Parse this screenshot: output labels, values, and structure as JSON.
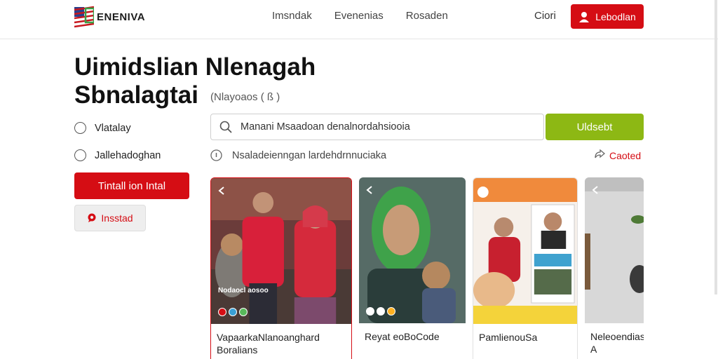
{
  "header": {
    "logo_text": "ENENIVA",
    "nav": [
      "Imsndak",
      "Evenenias",
      "Rosaden"
    ],
    "login": "Ciori",
    "signup": "Lebodlan"
  },
  "hero": {
    "title": "Uimidslian Nlenagah Sbnalagtai",
    "subtitle": "(Nlayoaos ( ß )"
  },
  "options": [
    {
      "label": "Vlatalay"
    },
    {
      "label": "Jallehadoghan"
    }
  ],
  "buttons": {
    "install": "Tintall ion Intal",
    "secondary": "Insstad"
  },
  "search": {
    "value": "Manani Msaadoan denalnordahsiooia",
    "button": "Uldsebt"
  },
  "info": {
    "text": "Nsaladeienngan lardehdrnnuciaka",
    "share": "Caoted"
  },
  "cards": [
    {
      "caption": "VapaarkaNlanoanghard Boralians",
      "overlay": "Nodaocl aosoo"
    },
    {
      "caption": "Reyat eoBoCode",
      "overlay": ""
    },
    {
      "caption": "PamlienouSa",
      "overlay": ""
    },
    {
      "caption": "Neleoendias A",
      "overlay": ""
    }
  ],
  "colors": {
    "brand_red": "#d50d14",
    "accent_green": "#8db814"
  }
}
